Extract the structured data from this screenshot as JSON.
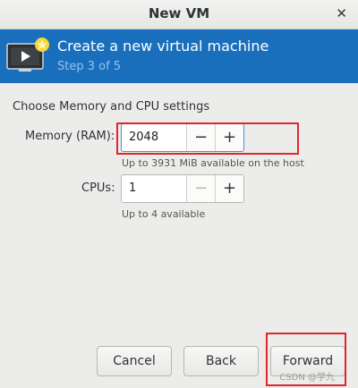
{
  "window": {
    "title": "New VM"
  },
  "banner": {
    "heading": "Create a new virtual machine",
    "step": "Step 3 of 5",
    "colors": {
      "background": "#1a6fbd",
      "step_text": "#8ec3f0"
    }
  },
  "form": {
    "section_label": "Choose Memory and CPU settings",
    "memory": {
      "label": "Memory (RAM):",
      "value": "2048",
      "decrement": "−",
      "increment": "+",
      "hint": "Up to 3931 MiB available on the host"
    },
    "cpus": {
      "label": "CPUs:",
      "value": "1",
      "decrement": "−",
      "increment": "+",
      "hint": "Up to 4 available"
    }
  },
  "footer": {
    "cancel_label": "Cancel",
    "back_label": "Back",
    "forward_label": "Forward"
  },
  "watermark": "CSDN @学九",
  "annotation_color": "#e0262b"
}
